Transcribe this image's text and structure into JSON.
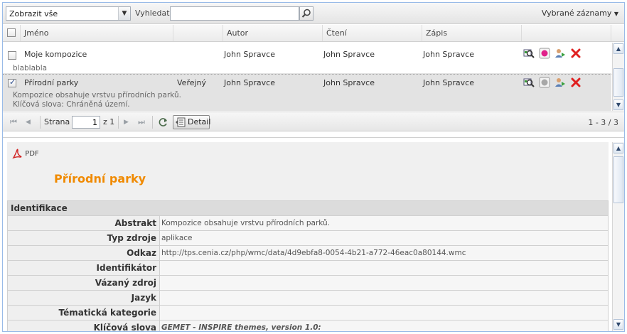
{
  "toolbar": {
    "filter_selected": "Zobrazit vše",
    "search_label": "Vyhledat:",
    "search_value": "",
    "selected_records_label": "Vybrané záznamy"
  },
  "grid": {
    "columns": [
      "Jméno",
      "",
      "Autor",
      "Čtení",
      "Zápis"
    ],
    "rows": [
      {
        "checked": false,
        "name": "Moje kompozice",
        "access": "",
        "author": "John Spravce",
        "read": "John Spravce",
        "write": "John Spravce",
        "description": "blablabla",
        "keywords": ""
      },
      {
        "checked": true,
        "name": "Přírodní parky",
        "access": "Veřejný",
        "author": "John Spravce",
        "read": "John Spravce",
        "write": "John Spravce",
        "description": "Kompozice obsahuje vrstvu přírodních parků.",
        "keywords": "Klíčová slova: Chráněná území."
      }
    ]
  },
  "pager": {
    "first": "⏮",
    "prev": "◀",
    "page_label": "Strana",
    "page_value": "1",
    "of_label": "z 1",
    "next": "▶",
    "last": "⏭",
    "detail_label": "Detail",
    "range": "1 - 3 / 3"
  },
  "detail": {
    "pdf_label": "PDF",
    "title": "Přírodní parky",
    "section": "Identifikace",
    "fields": [
      {
        "key": "Abstrakt",
        "value": "Kompozice obsahuje vrstvu přírodních parků."
      },
      {
        "key": "Typ zdroje",
        "value": "aplikace"
      },
      {
        "key": "Odkaz",
        "value": "http://tps.cenia.cz/php/wmc/data/4d9ebfa8-0054-4b21-a772-46eac0a80144.wmc"
      },
      {
        "key": "Identifikátor",
        "value": ""
      },
      {
        "key": "Vázaný zdroj",
        "value": ""
      },
      {
        "key": "Jazyk",
        "value": ""
      },
      {
        "key": "Tématická kategorie",
        "value": ""
      },
      {
        "key": "Klíčová slova",
        "value": "GEMET - INSPIRE themes, version 1.0:"
      }
    ]
  },
  "colors": {
    "accent_title": "#f08a00",
    "selected_row": "#e3e3e3",
    "border_blue": "#99bbe8"
  },
  "icons": [
    "dropdown-arrow-icon",
    "search-icon",
    "zoom-map-icon",
    "status-dot-icon",
    "share-user-icon",
    "delete-icon",
    "refresh-icon",
    "detail-icon",
    "pdf-icon",
    "scroll-up-icon",
    "scroll-down-icon"
  ]
}
